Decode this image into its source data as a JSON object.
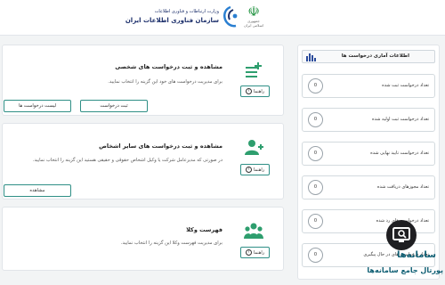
{
  "header": {
    "gov_emblem_text": "☫",
    "gov_caption": "جمهوری اسلامی ایران",
    "ministry_line1": "وزارت ارتباطات و فناوری اطلاعات",
    "ministry_line2": "سازمان فناوری اطلاعات ایران"
  },
  "cards": [
    {
      "title": "مشاهده و ثبت درخواست های شخصی",
      "desc": "برای مدیریت درخواست های خود این گزینه را انتخاب نمایید.",
      "help": "راهنما",
      "icon": "add-list-icon",
      "buttons": [
        "ثبت درخواست",
        "لیست درخواست ها"
      ]
    },
    {
      "title": "مشاهده و ثبت درخواست های سایر اشخاص",
      "desc": "در صورتی که مدیرعامل شرکت یا وکیل اشخاص حقوقی و حقیقی هستید این گزینه را انتخاب نمایید.",
      "help": "راهنما",
      "icon": "user-add-icon",
      "buttons": [
        "مشاهده"
      ]
    },
    {
      "title": "فهرست وکلا",
      "desc": "برای مدیریت فهرست وکلا این گزینه را انتخاب نمایید.",
      "help": "راهنما",
      "icon": "users-group-icon",
      "buttons": [
        "مشاهده"
      ]
    }
  ],
  "stats": {
    "title": "اطلاعات آماری درخواست ها",
    "icon": "bar-chart-icon",
    "rows": [
      {
        "label": "تعداد درخواست ثبت شده",
        "value": "0"
      },
      {
        "label": "تعداد درخواست ثبت اولیه شده",
        "value": "0"
      },
      {
        "label": "تعداد درخواست تایید نهایی شده",
        "value": "0"
      },
      {
        "label": "تعداد مجوزهای دریافت شده",
        "value": "0"
      },
      {
        "label": "تعداد درخواست های رد شده",
        "value": "0"
      },
      {
        "label": "تعداد درخواست های در حال پیگیری",
        "value": "0"
      }
    ]
  },
  "watermark": {
    "line1": "سامانه‌ها",
    "line2": "پورتال جامع سامانه‌ها"
  },
  "colors": {
    "accent": "#2f8f86",
    "icon_green": "#2e9e6e",
    "chart_blue": "#2b4b9b"
  }
}
